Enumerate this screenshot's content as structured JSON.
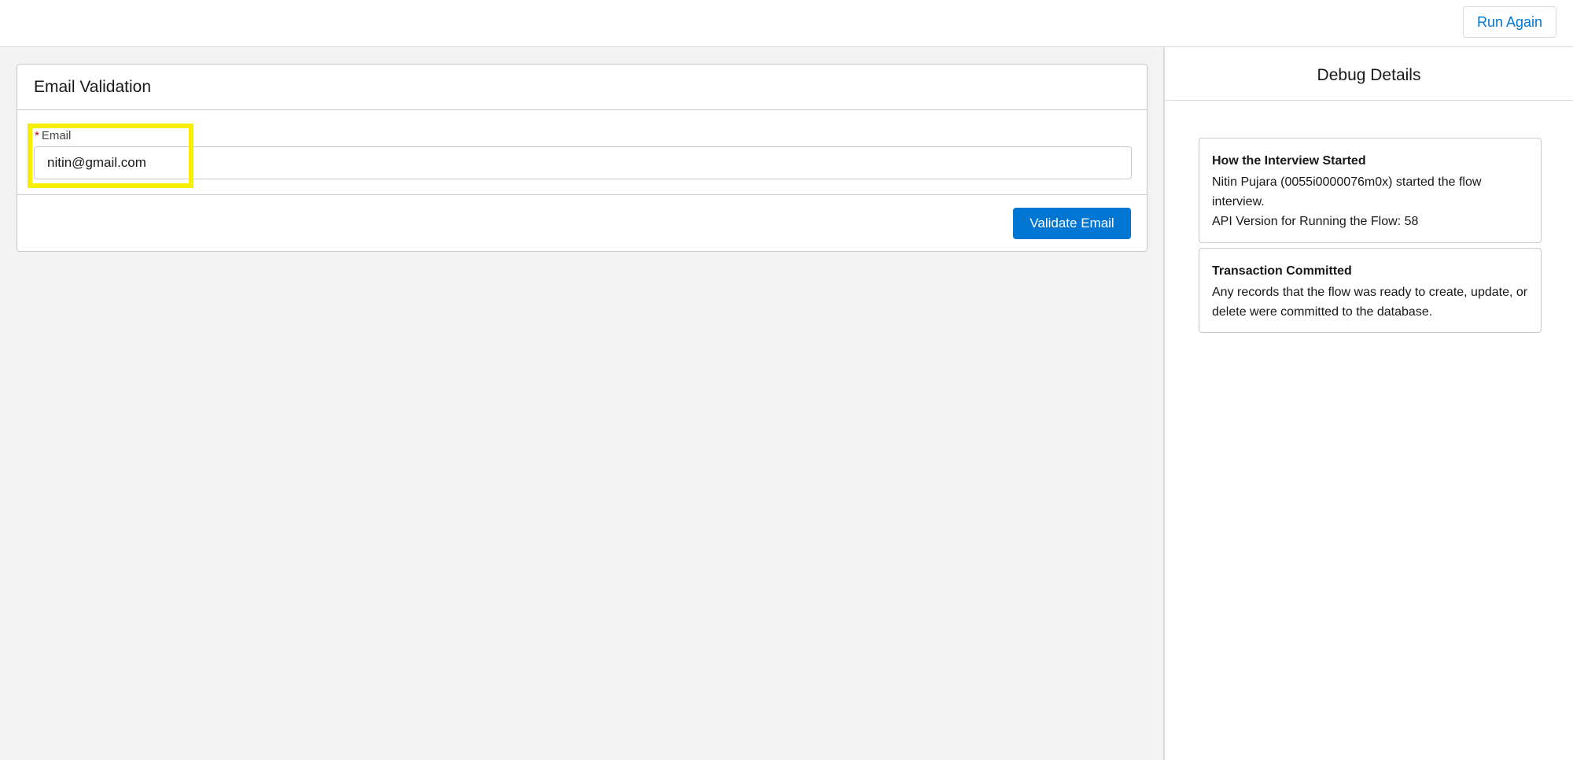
{
  "topbar": {
    "run_again_label": "Run Again"
  },
  "form": {
    "title": "Email Validation",
    "email_required_marker": "*",
    "email_label": "Email",
    "email_value": "nitin@gmail.com",
    "validate_label": "Validate Email"
  },
  "debug": {
    "title": "Debug Details",
    "cards": [
      {
        "title": "How the Interview Started",
        "lines": [
          "Nitin Pujara (0055i0000076m0x) started the flow interview.",
          "API Version for Running the Flow: 58"
        ]
      },
      {
        "title": "Transaction Committed",
        "lines": [
          "Any records that the flow was ready to create, update, or delete were committed to the database."
        ]
      }
    ]
  },
  "colors": {
    "accent": "#0176d3",
    "highlight": "#f7ef00",
    "required": "#ba0517"
  }
}
